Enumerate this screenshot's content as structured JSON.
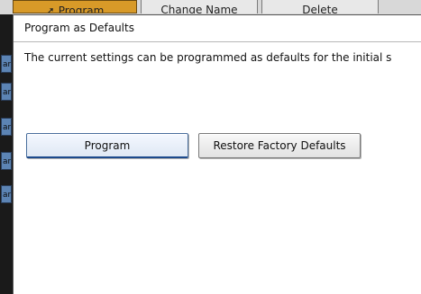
{
  "tabs": [
    {
      "label": "Program"
    },
    {
      "label": "Change Name"
    },
    {
      "label": "Delete"
    }
  ],
  "background_items": [
    "ar",
    "ar",
    "ar",
    "ar",
    "ar"
  ],
  "dialog": {
    "title": "Program as Defaults",
    "message": "The current settings can be programmed as defaults for the initial s",
    "buttons": {
      "program": "Program",
      "restore": "Restore Factory Defaults"
    }
  },
  "colors": {
    "active_tab": "#d89a28",
    "side_item": "#5c84b4",
    "primary_border": "#1c4a8c"
  }
}
